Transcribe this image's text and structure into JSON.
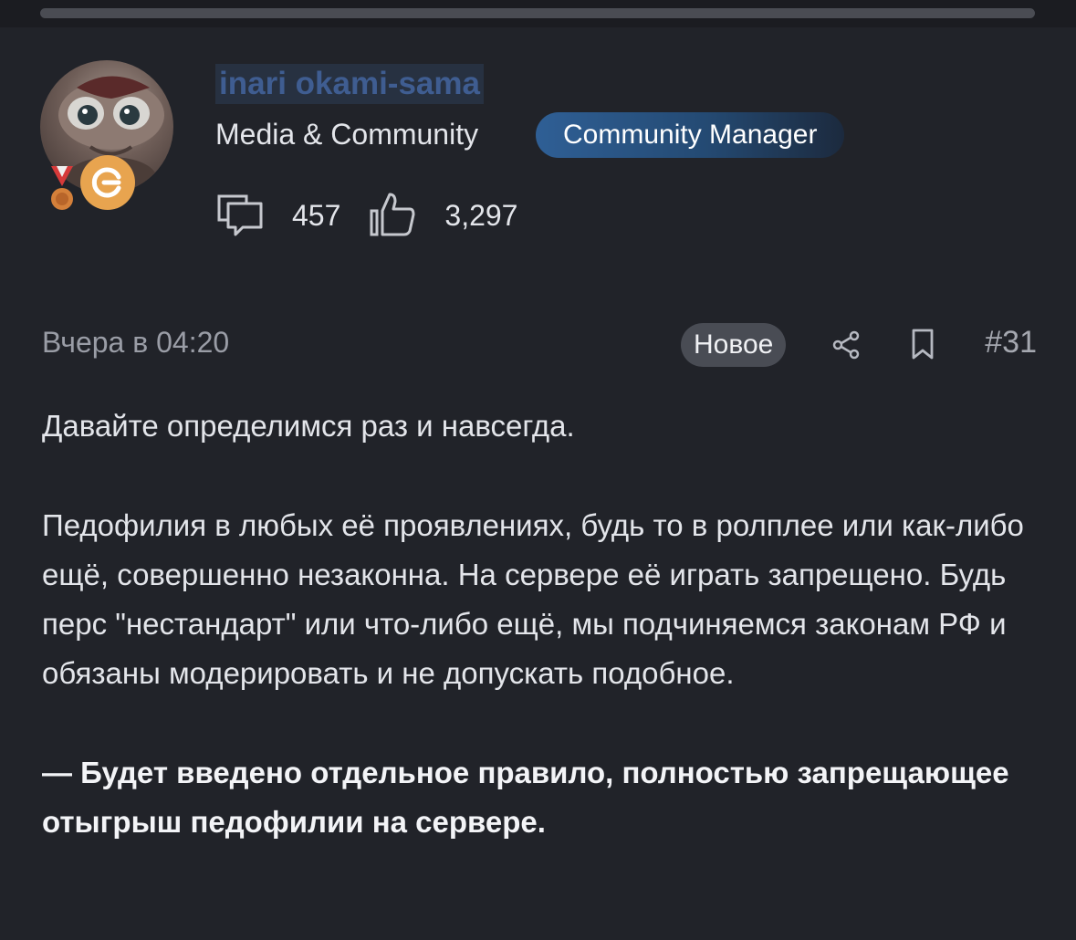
{
  "user": {
    "name": "inari okami-sama",
    "group": "Media & Community",
    "role": "Community Manager",
    "avatar_icon": "avatar-image",
    "medal_icon": "medal-icon",
    "badge_icon": "g-badge-icon",
    "badge_color": "#e8a44f"
  },
  "stats": {
    "messages_icon": "messages-icon",
    "messages": "457",
    "likes_icon": "thumbs-up-icon",
    "likes": "3,297"
  },
  "post": {
    "time": "Вчера в 04:20",
    "new_label": "Новое",
    "share_icon": "share-icon",
    "bookmark_icon": "bookmark-icon",
    "number": "#31",
    "paragraphs": [
      "Давайте определимся раз и навсегда.",
      "Педофилия в любых её проявлениях, будь то в ролплее или как-либо ещё, совершенно незаконна. На сервере её играть запрещено. Будь перс \"нестандарт\" или что-либо ещё, мы подчиняемся законам РФ и обязаны модерировать и не допускать подобное.",
      "— Будет введено отдельное правило, полностью запрещающее отыгрыш педофилии на сервере."
    ]
  },
  "colors": {
    "background": "#212329",
    "text": "#e3e5ea",
    "muted": "#9a9da6",
    "username": "#3f5d91",
    "role_badge": "#2f5f95"
  }
}
